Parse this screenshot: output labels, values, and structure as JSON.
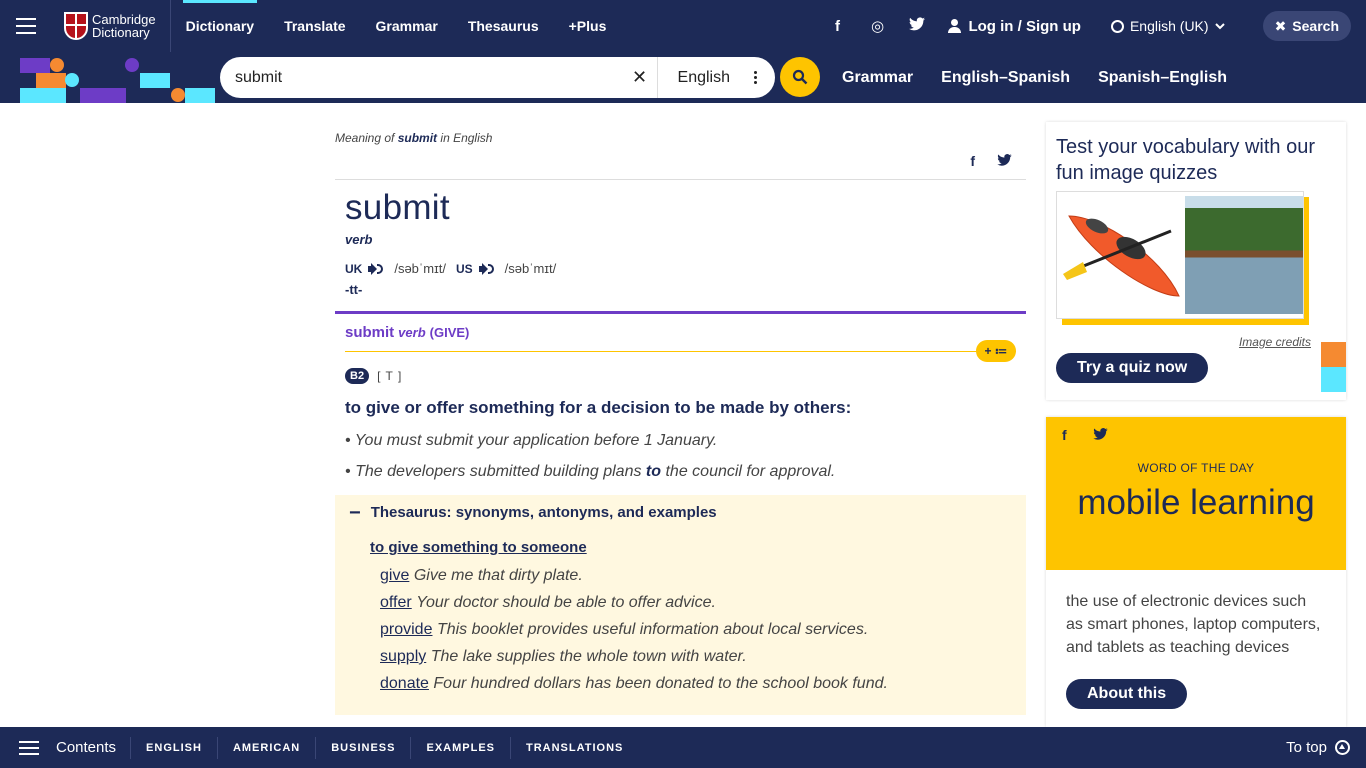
{
  "header": {
    "logo_line1": "Cambridge",
    "logo_line2": "Dictionary",
    "nav": [
      "Dictionary",
      "Translate",
      "Grammar",
      "Thesaurus",
      "+Plus"
    ],
    "social": {
      "facebook": "f",
      "instagram": "◎",
      "twitter": "🐦"
    },
    "login": "Log in / Sign up",
    "language": "English (UK)",
    "search_label": "Search"
  },
  "searchbar": {
    "query": "submit",
    "clear": "✕",
    "dictionary": "English",
    "links": [
      "Grammar",
      "English–Spanish",
      "Spanish–English"
    ]
  },
  "entry": {
    "meaning_prefix": "Meaning of",
    "meaning_word": "submit",
    "meaning_suffix": "in English",
    "share": {
      "facebook": "f",
      "twitter": "🐦"
    },
    "headword": "submit",
    "pos": "verb",
    "uk_label": "UK",
    "uk_ipa": "/səbˈmɪt/",
    "us_label": "US",
    "us_ipa": "/səbˈmɪt/",
    "inflection": "-tt-",
    "sense_word": "submit",
    "sense_pos": "verb",
    "sense_guide": "(GIVE)",
    "pill": "+ ≔",
    "level": "B2",
    "grammar": "[ T ]",
    "definition": "to give or offer something for a decision to be made by others:",
    "examples": [
      {
        "bullet": "•",
        "text": "You must submit your application before 1 January."
      },
      {
        "bullet": "•",
        "before": "The developers submitted building plans",
        "bold": "to",
        "after": "the council for approval."
      }
    ],
    "thesaurus_minus": "−",
    "thesaurus_title": "Thesaurus: synonyms, antonyms, and examples",
    "thesaurus_sub": "to give something to someone",
    "synonyms": [
      {
        "word": "give",
        "example": "Give me that dirty plate."
      },
      {
        "word": "offer",
        "example": "Your doctor should be able to offer advice."
      },
      {
        "word": "provide",
        "example": "This booklet provides useful information about local services."
      },
      {
        "word": "supply",
        "example": "The lake supplies the whole town with water."
      },
      {
        "word": "donate",
        "example": "Four hundred dollars has been donated to the school book fund."
      }
    ]
  },
  "quiz": {
    "title": "Test your vocabulary with our fun image quizzes",
    "credits": "Image credits",
    "button": "Try a quiz now"
  },
  "wotd": {
    "share": {
      "facebook": "f",
      "twitter": "🐦"
    },
    "label": "WORD OF THE DAY",
    "word": "mobile learning",
    "definition": "the use of electronic devices such as smart phones, laptop computers, and tablets as teaching devices",
    "button": "About this"
  },
  "bottom": {
    "contents": "Contents",
    "tabs": [
      "ENGLISH",
      "AMERICAN",
      "BUSINESS",
      "EXAMPLES",
      "TRANSLATIONS"
    ],
    "totop": "To top"
  },
  "colors": {
    "navy": "#1d2a57",
    "yellow": "#fec400",
    "purple": "#6d3cc6",
    "cyan": "#5be7ff",
    "orange": "#f58a31"
  }
}
